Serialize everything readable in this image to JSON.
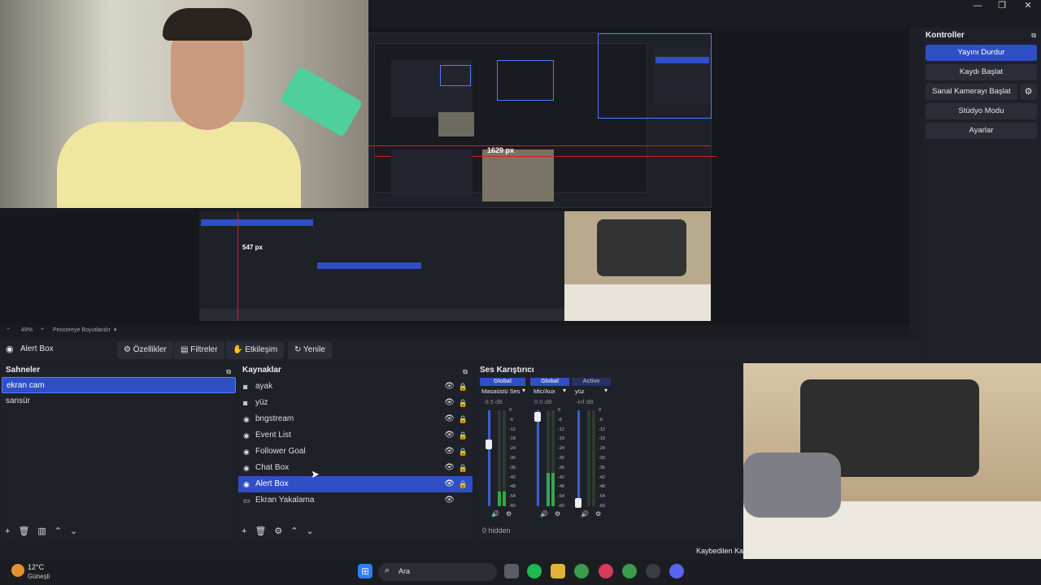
{
  "window": {
    "minimize": "—",
    "restore": "❐",
    "close": "✕"
  },
  "zoom": {
    "minus": "−",
    "level": "49%",
    "plus": "+",
    "mode": "Pencereye Boyutlandır"
  },
  "source_toolbar": {
    "selected_source": "Alert Box",
    "properties": "Özellikler",
    "filters": "Filtreler",
    "interact": "Etkileşim",
    "refresh": "Yenile"
  },
  "scenes": {
    "title": "Sahneler",
    "items": [
      "ekran cam",
      "sansür"
    ]
  },
  "sources": {
    "title": "Kaynaklar",
    "items": [
      {
        "label": "ayak",
        "icon": "camera-icon"
      },
      {
        "label": "yüz",
        "icon": "camera-icon"
      },
      {
        "label": "bngstream",
        "icon": "browser-icon"
      },
      {
        "label": "Event List",
        "icon": "browser-icon"
      },
      {
        "label": "Follower Goal",
        "icon": "browser-icon"
      },
      {
        "label": "Chat Box",
        "icon": "browser-icon"
      },
      {
        "label": "Alert Box",
        "icon": "browser-icon"
      },
      {
        "label": "Ekran Yakalama",
        "icon": "monitor-icon"
      }
    ]
  },
  "mixer": {
    "title": "Ses Karıştırıcı",
    "channels": [
      {
        "group": "Global",
        "name": "Masaüstü Ses",
        "db": "-9.5 dB",
        "level": 0.15
      },
      {
        "group": "Global",
        "name": "Mic/Aux",
        "db": "0.0 dB",
        "level": 0.35
      },
      {
        "group": "Active",
        "name": "yüz",
        "db": "-inf dB",
        "level": 0.0
      }
    ],
    "ticks": [
      "0",
      "-6",
      "-12",
      "-18",
      "-24",
      "-30",
      "-36",
      "-42",
      "-48",
      "-54",
      "-60"
    ],
    "hidden": "0 hidden"
  },
  "controls": {
    "title": "Kontroller",
    "stop_stream": "Yayını Durdur",
    "start_record": "Kaydı Başlat",
    "start_virtualcam": "Sanal Kamerayı Başlat",
    "studio_mode": "Stüdyo Modu",
    "settings": "Ayarlar"
  },
  "preview_overlay": {
    "px_label_1": "1629 px",
    "px_label_2": "547 px"
  },
  "status": {
    "dropped": "Kaybedilen Kar"
  },
  "taskbar": {
    "weather_temp": "12°C",
    "weather_desc": "Güneşli",
    "search": "Ara"
  },
  "colors": {
    "accent": "#2f4fc4",
    "bg": "#1f2128"
  }
}
